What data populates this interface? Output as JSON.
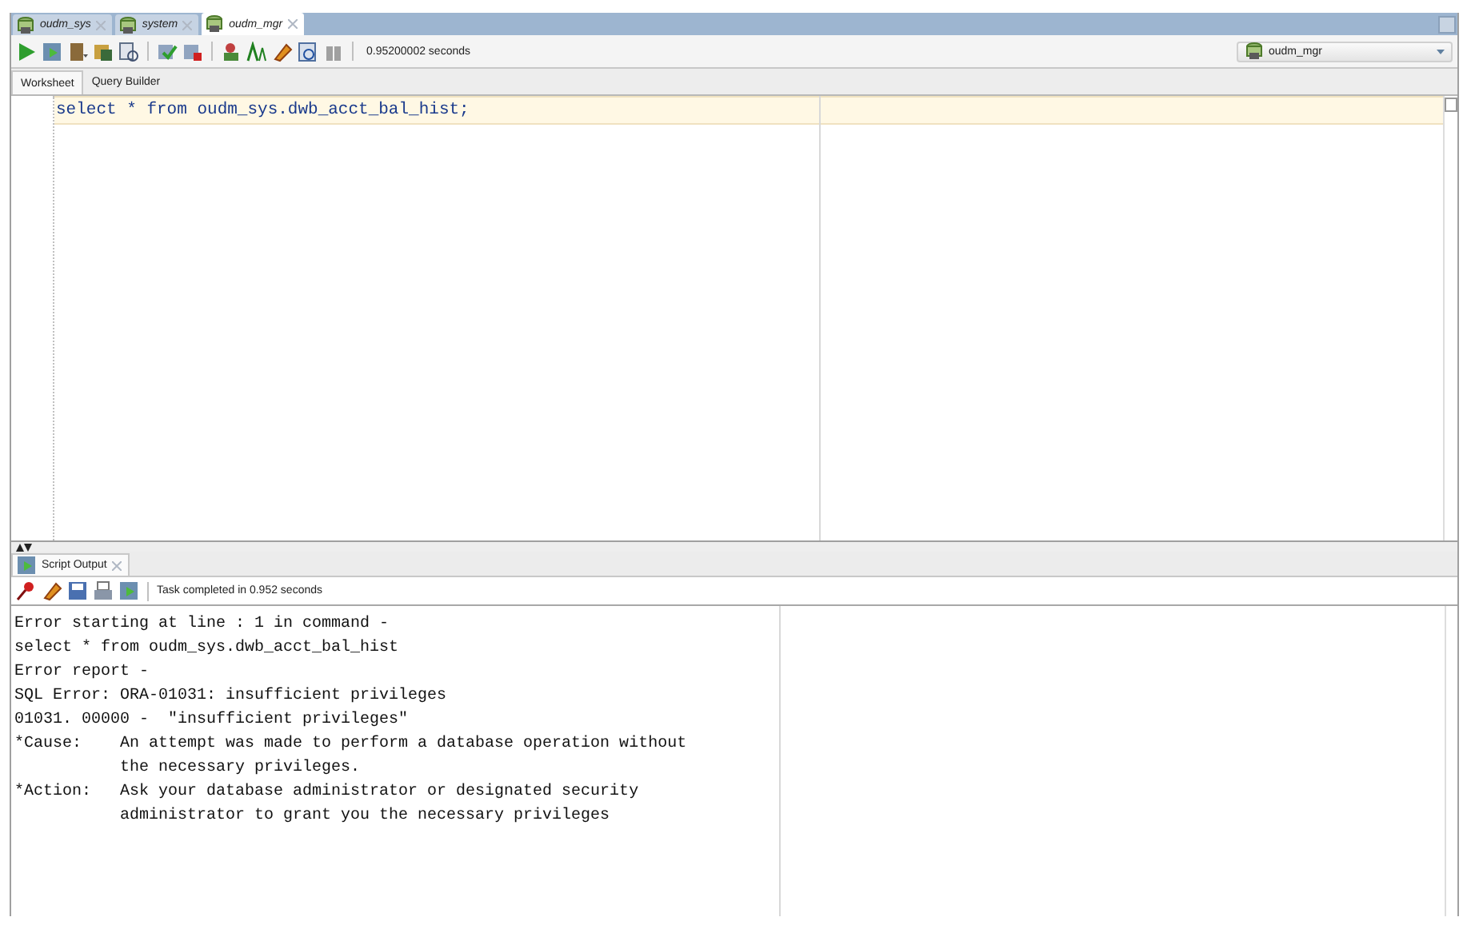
{
  "document_tabs": [
    {
      "label": "oudm_sys",
      "selected": false
    },
    {
      "label": "system",
      "selected": false
    },
    {
      "label": "oudm_mgr",
      "selected": true
    }
  ],
  "toolbar": {
    "timing": "0.95200002 seconds",
    "connection": "oudm_mgr"
  },
  "editor_tabs": [
    {
      "label": "Worksheet",
      "selected": true
    },
    {
      "label": "Query Builder",
      "selected": false
    }
  ],
  "editor": {
    "lines": [
      "select * from oudm_sys.dwb_acct_bal_hist;"
    ]
  },
  "output_panel": {
    "tab": "Script Output",
    "status": "Task completed in 0.952 seconds",
    "lines": [
      "Error starting at line : 1 in command -",
      "select * from oudm_sys.dwb_acct_bal_hist",
      "Error report -",
      "SQL Error: ORA-01031: insufficient privileges",
      "01031. 00000 -  \"insufficient privileges\"",
      "*Cause:    An attempt was made to perform a database operation without",
      "           the necessary privileges.",
      "*Action:   Ask your database administrator or designated security",
      "           administrator to grant you the necessary privileges"
    ]
  }
}
